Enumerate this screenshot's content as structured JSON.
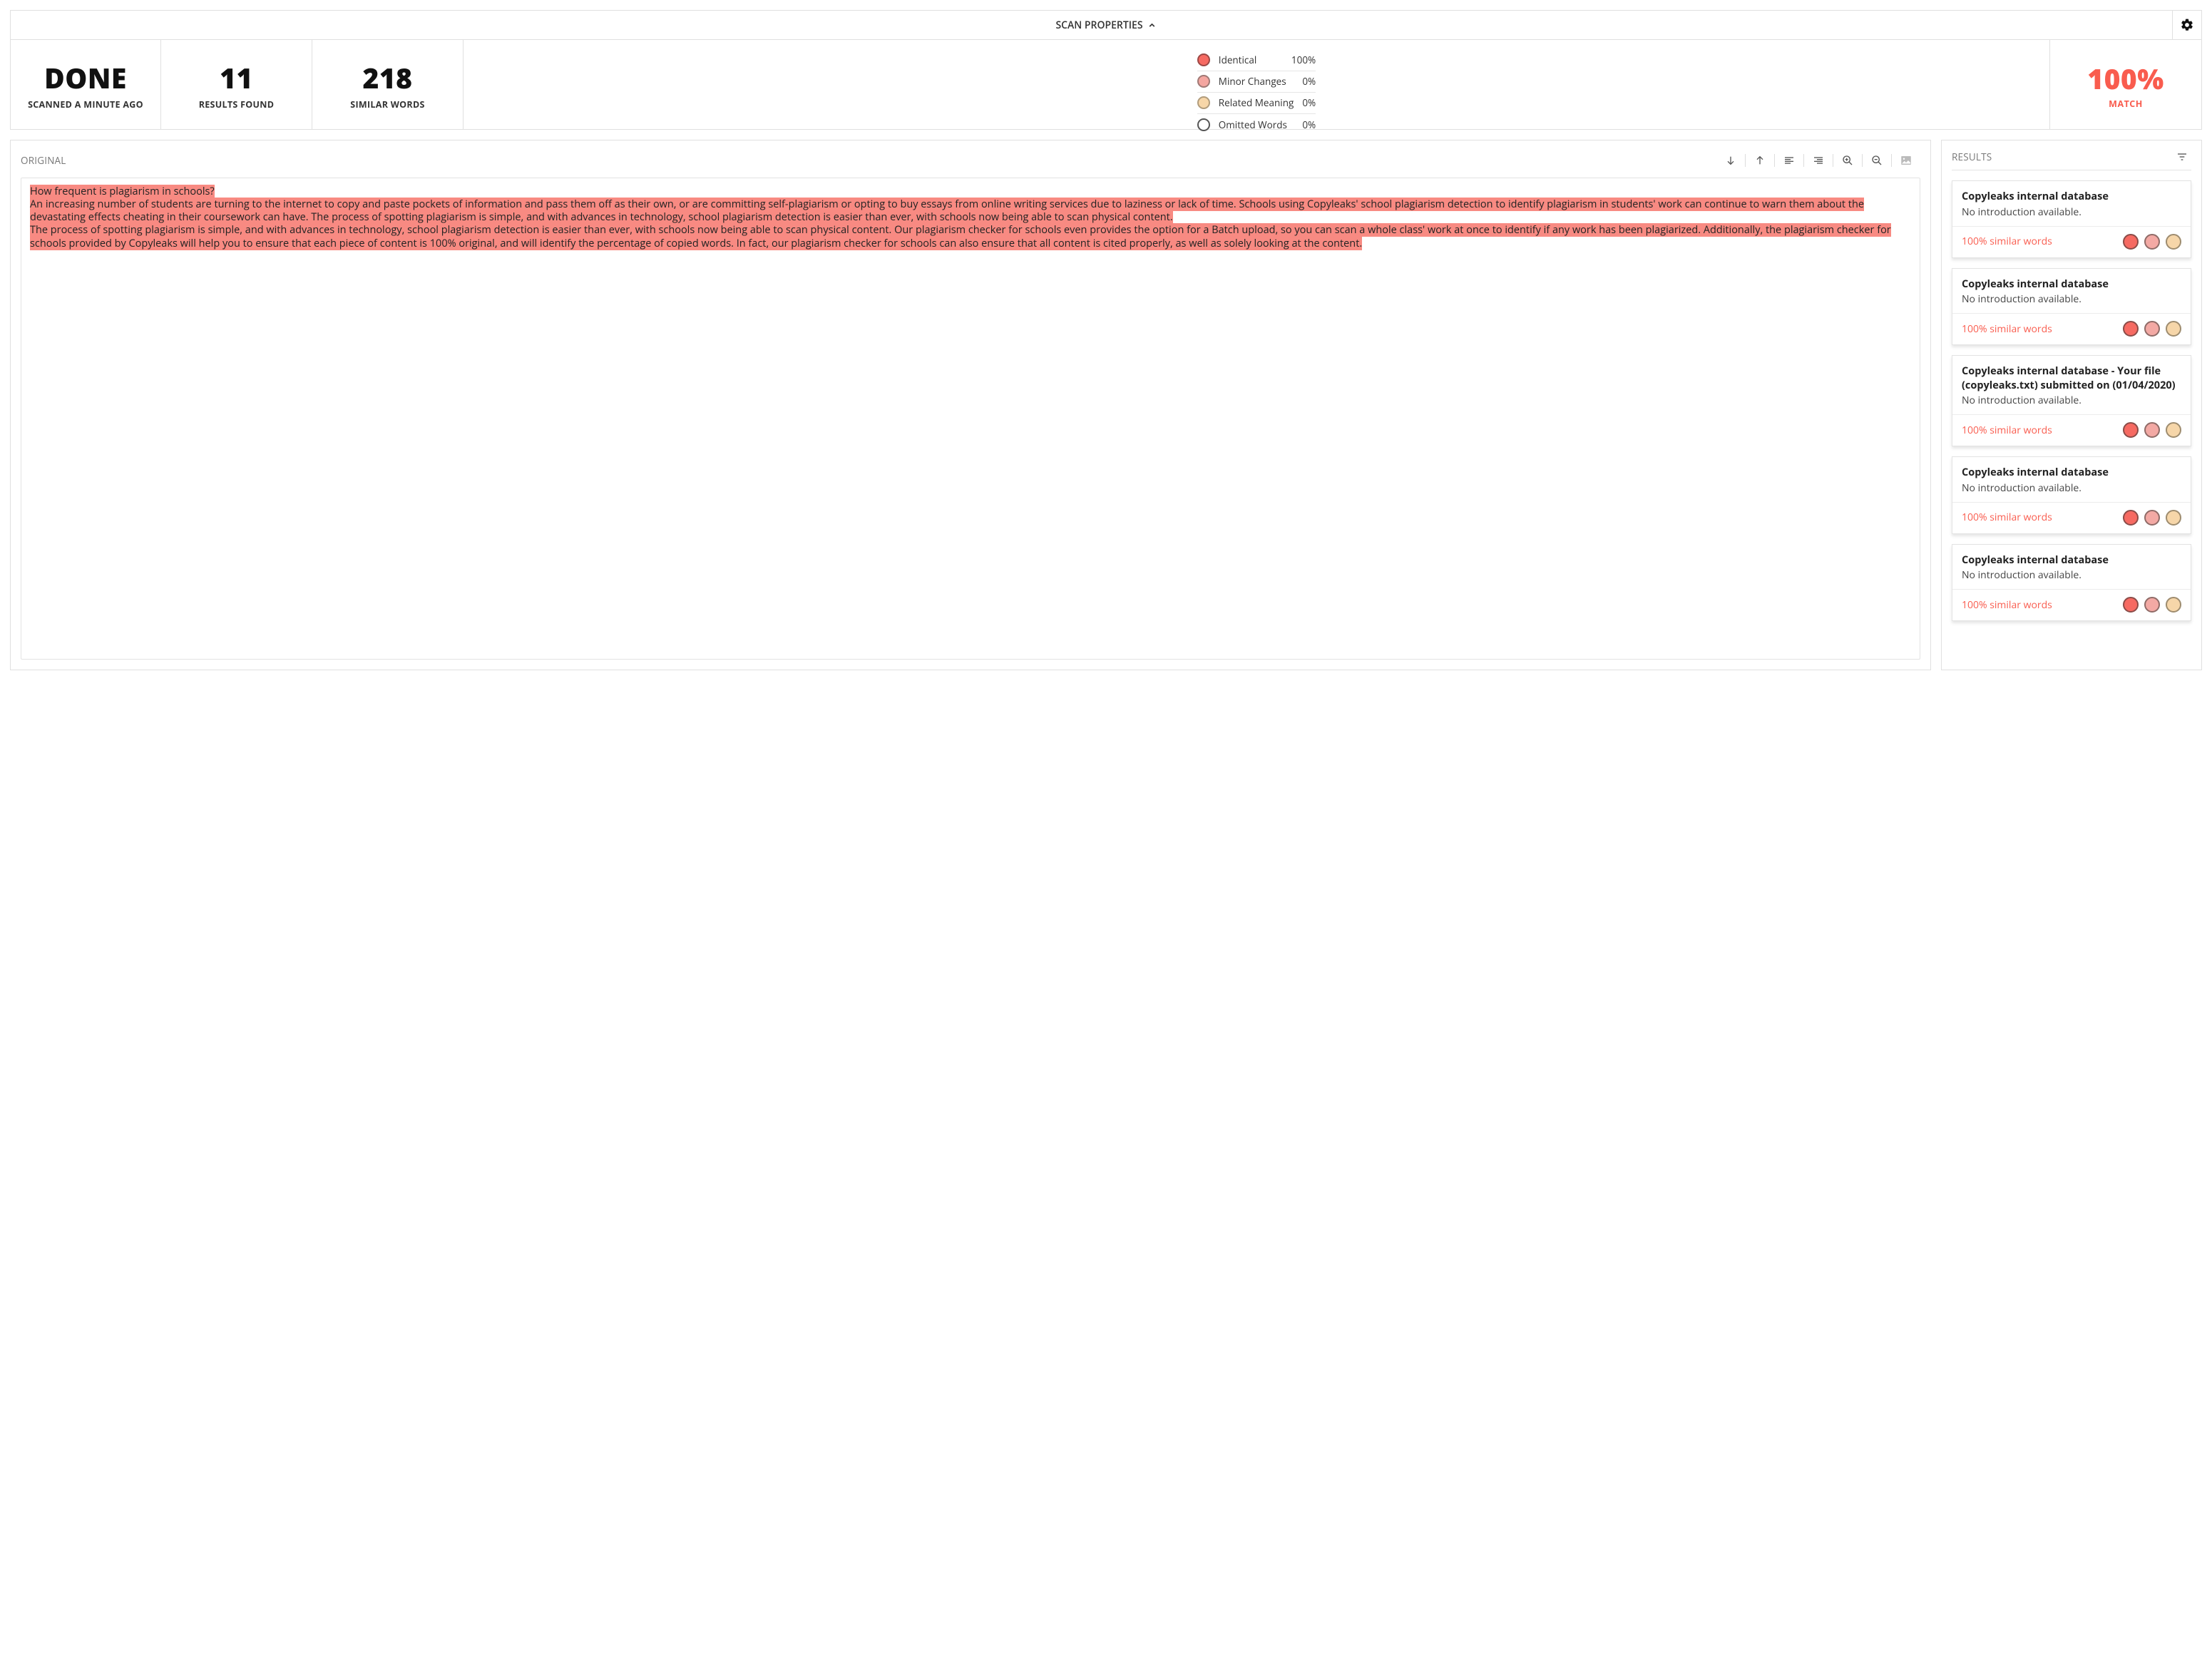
{
  "topbar": {
    "title": "SCAN PROPERTIES"
  },
  "stats": {
    "done_label": "DONE",
    "done_sub": "SCANNED A MINUTE AGO",
    "results_value": "11",
    "results_label": "RESULTS FOUND",
    "words_value": "218",
    "words_label": "SIMILAR WORDS",
    "match_value": "100%",
    "match_label": "MATCH"
  },
  "legend": {
    "identical": {
      "label": "Identical",
      "value": "100%"
    },
    "minor": {
      "label": "Minor Changes",
      "value": "0%"
    },
    "related": {
      "label": "Related Meaning",
      "value": "0%"
    },
    "omitted": {
      "label": "Omitted Words",
      "value": "0%"
    }
  },
  "original": {
    "title": "ORIGINAL",
    "text": "How frequent is plagiarism in schools?\nAn increasing number of students are turning to the internet to copy and paste pockets of information and pass them off as their own, or are committing self-plagiarism or opting to buy essays from online writing services due to laziness or lack of time. Schools using Copyleaks' school plagiarism detection to identify plagiarism in students' work can continue to warn them about the devastating effects cheating in their coursework can have. The process of spotting plagiarism is simple, and with advances in technology, school plagiarism detection is easier than ever, with schools now being able to scan physical content.\nThe process of spotting plagiarism is simple, and with advances in technology, school plagiarism detection is easier than ever, with schools now being able to scan physical content. Our plagiarism checker for schools even provides the option for a Batch upload, so you can scan a whole class' work at once to identify if any work has been plagiarized. Additionally, the plagiarism checker for schools provided by Copyleaks will help you to ensure that each piece of content is 100% original, and will identify the percentage of copied words. In fact, our plagiarism checker for schools can also ensure that all content is cited properly, as well as solely looking at the content."
  },
  "results": {
    "title": "RESULTS",
    "items": [
      {
        "name": "Copyleaks internal database",
        "desc": "No introduction available.",
        "sim": "100% similar words"
      },
      {
        "name": "Copyleaks internal database",
        "desc": "No introduction available.",
        "sim": "100% similar words"
      },
      {
        "name": "Copyleaks internal database - Your file (copyleaks.txt) submitted on (01/04/2020)",
        "desc": "No introduction available.",
        "sim": "100% similar words"
      },
      {
        "name": "Copyleaks internal database",
        "desc": "No introduction available.",
        "sim": "100% similar words"
      },
      {
        "name": "Copyleaks internal database",
        "desc": "No introduction available.",
        "sim": "100% similar words"
      }
    ]
  }
}
